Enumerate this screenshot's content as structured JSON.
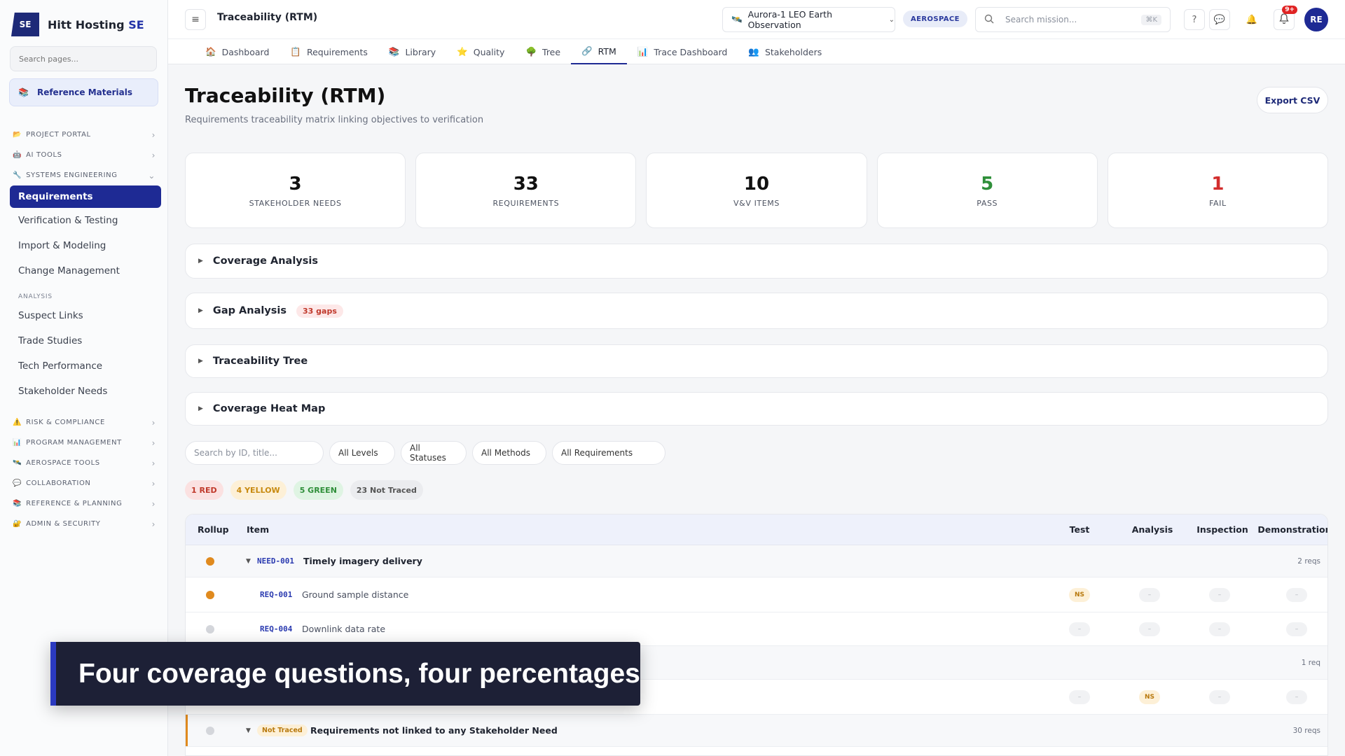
{
  "brand": {
    "logo": "SE",
    "name": "Hitt Hosting",
    "suffix": "SE"
  },
  "sidebar": {
    "search_placeholder": "Search pages...",
    "pinned": {
      "icon": "books-icon",
      "label": "Reference Materials"
    },
    "sections_top": [
      {
        "icon": "folder-icon",
        "label": "PROJECT PORTAL"
      },
      {
        "icon": "robot-icon",
        "label": "AI TOOLS"
      },
      {
        "icon": "wrench-icon",
        "label": "SYSTEMS ENGINEERING"
      }
    ],
    "se_items": [
      "Requirements",
      "Verification & Testing",
      "Import & Modeling",
      "Change Management"
    ],
    "analysis_label": "ANALYSIS",
    "analysis_items": [
      "Suspect Links",
      "Trade Studies",
      "Tech Performance",
      "Stakeholder Needs"
    ],
    "sections_bottom": [
      {
        "icon": "warning-icon",
        "label": "RISK & COMPLIANCE"
      },
      {
        "icon": "bar-chart-icon",
        "label": "PROGRAM MANAGEMENT"
      },
      {
        "icon": "satellite-icon",
        "label": "AEROSPACE TOOLS"
      },
      {
        "icon": "chat-icon",
        "label": "COLLABORATION"
      },
      {
        "icon": "books-icon",
        "label": "REFERENCE & PLANNING"
      },
      {
        "icon": "lock-icon",
        "label": "ADMIN & SECURITY"
      }
    ]
  },
  "topbar": {
    "page_title": "Traceability (RTM)",
    "mission": "Aurora-1 LEO Earth Observation",
    "tag": "AEROSPACE",
    "search_placeholder": "Search mission...",
    "shortcut": "⌘K",
    "help": "?",
    "notif_count": "9+",
    "avatar": "RE"
  },
  "tabs": [
    {
      "icon": "home-icon",
      "label": "Dashboard"
    },
    {
      "icon": "clipboard-icon",
      "label": "Requirements"
    },
    {
      "icon": "books-icon",
      "label": "Library"
    },
    {
      "icon": "star-icon",
      "label": "Quality"
    },
    {
      "icon": "tree-icon",
      "label": "Tree"
    },
    {
      "icon": "link-icon",
      "label": "RTM"
    },
    {
      "icon": "bar-chart-icon",
      "label": "Trace Dashboard"
    },
    {
      "icon": "people-icon",
      "label": "Stakeholders"
    }
  ],
  "header": {
    "title": "Traceability (RTM)",
    "subtitle": "Requirements traceability matrix linking objectives to verification",
    "export": "Export CSV"
  },
  "stats": [
    {
      "value": "3",
      "label": "STAKEHOLDER NEEDS"
    },
    {
      "value": "33",
      "label": "REQUIREMENTS"
    },
    {
      "value": "10",
      "label": "V&V ITEMS"
    },
    {
      "value": "5",
      "label": "PASS"
    },
    {
      "value": "1",
      "label": "FAIL"
    }
  ],
  "sections": {
    "coverage": "Coverage Analysis",
    "gap": "Gap Analysis",
    "gap_badge": "33 gaps",
    "tree": "Traceability Tree",
    "heat": "Coverage Heat Map"
  },
  "filters": {
    "search_placeholder": "Search by ID, title...",
    "levels": "All Levels",
    "statuses": "All Statuses",
    "methods": "All Methods",
    "reqs": "All Requirements"
  },
  "legend": {
    "red": "1 RED",
    "yellow": "4 YELLOW",
    "green": "5 GREEN",
    "not_traced": "23 Not Traced"
  },
  "table": {
    "columns": {
      "rollup": "Rollup",
      "item": "Item",
      "test": "Test",
      "analysis": "Analysis",
      "inspection": "Inspection",
      "demonstration": "Demonstration"
    },
    "need1": {
      "id": "NEED-001",
      "title": "Timely imagery delivery",
      "count": "2 reqs"
    },
    "req1": {
      "id": "REQ-001",
      "title": "Ground sample distance",
      "test": "NS",
      "analysis": "–",
      "inspection": "–",
      "demonstration": "–"
    },
    "req2": {
      "id": "REQ-004",
      "title": "Downlink data rate",
      "test": "–",
      "analysis": "–",
      "inspection": "–",
      "demonstration": "–"
    },
    "need2": {
      "count": "1 req"
    },
    "req3": {
      "test": "–",
      "analysis": "NS",
      "inspection": "–",
      "demonstration": "–"
    },
    "not_traced": {
      "badge": "Not Traced",
      "title": "Requirements not linked to any Stakeholder Need",
      "count": "30 reqs"
    }
  },
  "caption": "Four coverage questions, four percentages",
  "colors": {
    "brand": "#1e2a94",
    "rollup_orange": "#e08a1e",
    "pass": "#2f8f3a",
    "fail": "#d22d2d"
  }
}
